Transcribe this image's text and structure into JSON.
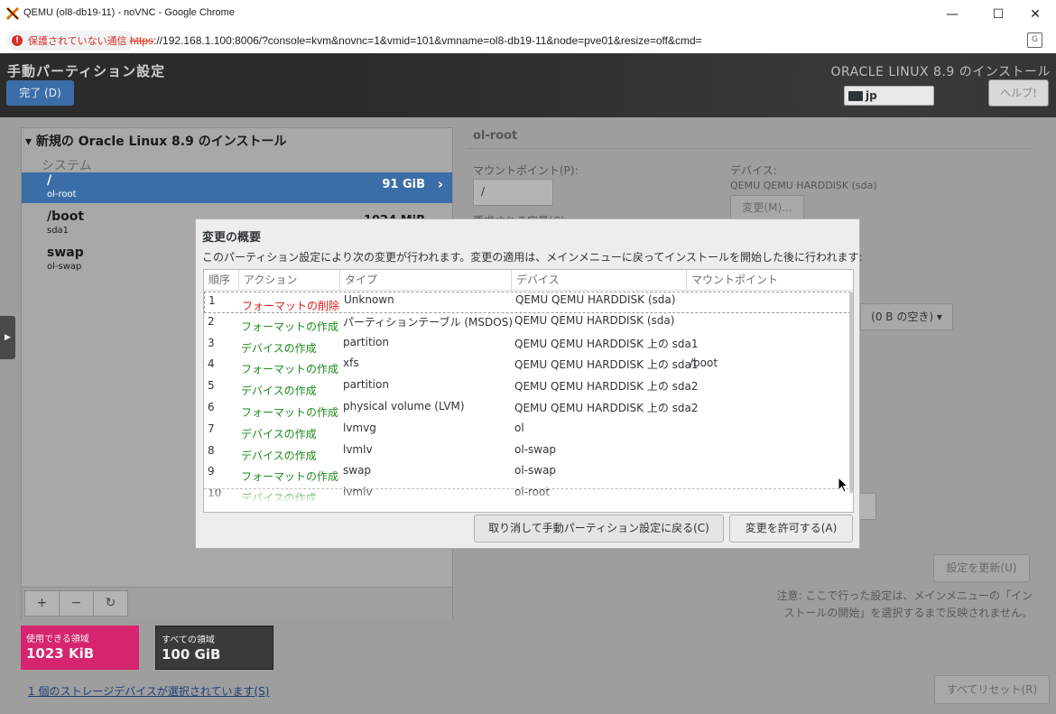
{
  "window": {
    "title": "QEMU (ol8-db19-11) - noVNC - Google Chrome",
    "minimize": "—",
    "maximize": "☐",
    "close": "✕"
  },
  "addressbar": {
    "security_text": "保護されていない通信",
    "url_scheme": "https",
    "url_rest": "://192.168.1.100:8006/?console=kvm&novnc=1&vmid=101&vmname=ol8-db19-11&node=pve01&resize=off&cmd="
  },
  "header": {
    "page_title": "手動パーティション設定",
    "done_label": "完了 (D)",
    "product": "ORACLE LINUX 8.9 のインストール",
    "keyboard": "jp",
    "help_label": "ヘルプ!"
  },
  "left": {
    "install_title": "新規の Oracle Linux 8.9 のインストール",
    "system_label": "システム",
    "mounts": [
      {
        "name": "/",
        "device": "ol-root",
        "size": "91 GiB"
      },
      {
        "name": "/boot",
        "device": "sda1",
        "size": "1024 MiB"
      },
      {
        "name": "swap",
        "device": "ol-swap",
        "size": ""
      }
    ],
    "add": "+",
    "remove": "−",
    "refresh": "↻"
  },
  "space": {
    "available_label": "使用できる領域",
    "available_value": "1023 KiB",
    "total_label": "すべての領域",
    "total_value": "100 GiB"
  },
  "storage_link": "1 個のストレージデバイスが選択されています(S)",
  "right": {
    "title": "ol-root",
    "mountpoint_label": "マウントポイント(P):",
    "mountpoint_value": "/",
    "device_label": "デバイス:",
    "device_value": "QEMU QEMU HARDDISK (sda)",
    "change_btn": "変更(M)...",
    "capacity_label": "要求される容量(C):",
    "free_text": "(0 B の空き) ▾",
    "update_btn": "設定を更新(U)",
    "note": "注意: ここで行った設定は、メインメニューの「インストールの開始」を選択するまで反映されません。",
    "reset_btn": "すべてリセット(R)"
  },
  "dialog": {
    "title": "変更の概要",
    "description": "このパーティション設定により次の変更が行われます。変更の適用は、メインメニューに戻ってインストールを開始した後に行われます:",
    "columns": [
      "順序",
      "アクション",
      "タイプ",
      "デバイス",
      "マウントポイント"
    ],
    "rows": [
      {
        "n": "1",
        "action": "フォーマットの削除",
        "kind": "delete",
        "type": "Unknown",
        "device": "QEMU QEMU HARDDISK (sda)",
        "mount": ""
      },
      {
        "n": "2",
        "action": "フォーマットの作成",
        "kind": "create",
        "type": "パーティションテーブル (MSDOS)",
        "device": "QEMU QEMU HARDDISK (sda)",
        "mount": ""
      },
      {
        "n": "3",
        "action": "デバイスの作成",
        "kind": "create",
        "type": "partition",
        "device": "QEMU QEMU HARDDISK 上の sda1",
        "mount": ""
      },
      {
        "n": "4",
        "action": "フォーマットの作成",
        "kind": "create",
        "type": "xfs",
        "device": "QEMU QEMU HARDDISK 上の sda1",
        "mount": "/boot"
      },
      {
        "n": "5",
        "action": "デバイスの作成",
        "kind": "create",
        "type": "partition",
        "device": "QEMU QEMU HARDDISK 上の sda2",
        "mount": ""
      },
      {
        "n": "6",
        "action": "フォーマットの作成",
        "kind": "create",
        "type": "physical volume (LVM)",
        "device": "QEMU QEMU HARDDISK 上の sda2",
        "mount": ""
      },
      {
        "n": "7",
        "action": "デバイスの作成",
        "kind": "create",
        "type": "lvmvg",
        "device": "ol",
        "mount": ""
      },
      {
        "n": "8",
        "action": "デバイスの作成",
        "kind": "create",
        "type": "lvmlv",
        "device": "ol-swap",
        "mount": ""
      },
      {
        "n": "9",
        "action": "フォーマットの作成",
        "kind": "create",
        "type": "swap",
        "device": "ol-swap",
        "mount": ""
      },
      {
        "n": "10",
        "action": "デバイスの作成",
        "kind": "create",
        "type": "lvmlv",
        "device": "ol-root",
        "mount": ""
      }
    ],
    "cancel_btn": "取り消して手動パーティション設定に戻る(C)",
    "accept_btn": "変更を許可する(A)"
  },
  "colors": {
    "selected": "#3b6ea8",
    "available_box": "#d6246e",
    "total_box": "#3a3a3a",
    "delete": "#e01b1b",
    "create": "#1d8a1d"
  }
}
